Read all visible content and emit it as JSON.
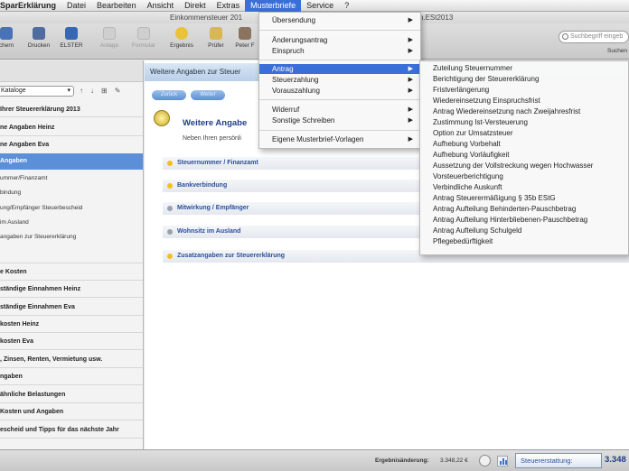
{
  "menubar": {
    "app": "SparErklärung",
    "items": [
      "Datei",
      "Bearbeiten",
      "Ansicht",
      "Direkt",
      "Extras",
      "Musterbriefe",
      "Service",
      "?"
    ],
    "active": "Musterbriefe"
  },
  "titlebar": {
    "left": "Einkommensteuer 201",
    "right": "ann.ESt2013"
  },
  "toolbar": {
    "buttons": [
      {
        "label": "chern",
        "icon": "save-icon",
        "enabled": true
      },
      {
        "label": "Drucken",
        "icon": "printer-icon",
        "enabled": true
      },
      {
        "label": "ELSTER",
        "icon": "elster-icon",
        "enabled": true
      },
      {
        "label": "Anlage",
        "icon": "document-icon",
        "enabled": false
      },
      {
        "label": "Formular",
        "icon": "form-icon",
        "enabled": false
      },
      {
        "label": "Ergebnis",
        "icon": "result-icon",
        "enabled": true
      },
      {
        "label": "Prüfer",
        "icon": "checker-icon",
        "enabled": true
      },
      {
        "label": "Peter F",
        "icon": "person-icon",
        "enabled": true
      }
    ],
    "search_placeholder": "Suchbegriff eingeb",
    "search_label": "Suchen"
  },
  "sidebar": {
    "dropdown_value": "Kataloge",
    "items": [
      {
        "label": "Ihrer Steuererklärung 2013",
        "style": "bold"
      },
      {
        "label": "ne Angaben Heinz",
        "style": "bold"
      },
      {
        "label": "ne Angaben Eva",
        "style": "bold"
      },
      {
        "label": "Angaben",
        "style": "selected"
      },
      {
        "label": "ummer/Finanzamt",
        "style": "sub"
      },
      {
        "label": "bindung",
        "style": "sub"
      },
      {
        "label": "ung/Empfänger Steuerbescheid",
        "style": "sub"
      },
      {
        "label": "im Ausland",
        "style": "sub"
      },
      {
        "label": "angaben zur Steuererklärung",
        "style": "sub"
      },
      {
        "label": "e Kosten",
        "style": "bold"
      },
      {
        "label": "ständige Einnahmen Heinz",
        "style": "bold"
      },
      {
        "label": "ständige Einnahmen Eva",
        "style": "bold"
      },
      {
        "label": "kosten Heinz",
        "style": "bold"
      },
      {
        "label": "kosten Eva",
        "style": "bold"
      },
      {
        "label": ", Zinsen, Renten, Vermietung usw.",
        "style": "bold"
      },
      {
        "label": "ngaben",
        "style": "bold"
      },
      {
        "label": "ähnliche Belastungen",
        "style": "bold"
      },
      {
        "label": "Kosten und Angaben",
        "style": "bold"
      },
      {
        "label": "escheid und Tipps für das nächste Jahr",
        "style": "bold"
      }
    ]
  },
  "main": {
    "header": "Weitere Angaben zur Steuer",
    "prev_button": "Zurück",
    "next_button": "Weiter",
    "title": "Weitere Angabe",
    "subtitle": "Neben Ihren persönli",
    "sections": [
      {
        "label": "Steuernummer / Finanzamt",
        "color": "#f0c020"
      },
      {
        "label": "Bankverbindung",
        "color": "#f0c020"
      },
      {
        "label": "Mitwirkung / Empfänger",
        "color": "#9aa3ad"
      },
      {
        "label": "Wohnsitz im Ausland",
        "color": "#9aa3ad"
      },
      {
        "label": "Zusatzangaben zur Steuererklärung",
        "color": "#f0c020"
      }
    ]
  },
  "statusbar": {
    "ergebnis_label": "Ergebnisänderung:",
    "ergebnis_value": "3.348,22 €",
    "steuer_label": "Steuererstattung:",
    "steuer_value": "3.348"
  },
  "menu_musterbriefe": {
    "items": [
      "Übersendung",
      "Änderungsantrag",
      "Einspruch",
      "Antrag",
      "Steuerzahlung",
      "Vorauszahlung",
      "Widerruf",
      "Sonstige Schreiben",
      "Eigene Musterbrief-Vorlagen"
    ],
    "highlighted": "Antrag"
  },
  "menu_antrag": {
    "items": [
      "Zuteilung Steuernummer",
      "Berichtigung der Steuererklärung",
      "Fristverlängerung",
      "Wiedereinsetzung Einspruchsfrist",
      "Antrag Wiedereinsetzung nach Zweijahresfrist",
      "Zustimmung Ist-Versteuerung",
      "Option zur Umsatzsteuer",
      "Aufhebung Vorbehalt",
      "Aufhebung Vorläufigkeit",
      "Aussetzung der Vollstreckung wegen Hochwasser",
      "Vorsteuerberichtigung",
      "Verbindliche Auskunft",
      "Antrag Steuerermäßigung § 35b EStG",
      "Antrag Aufteilung Behinderten-Pauschbetrag",
      "Antrag Aufteilung Hinterbliebenen-Pauschbetrag",
      "Antrag Aufteilung Schulgeld",
      "Pflegebedürftigkeit"
    ]
  }
}
